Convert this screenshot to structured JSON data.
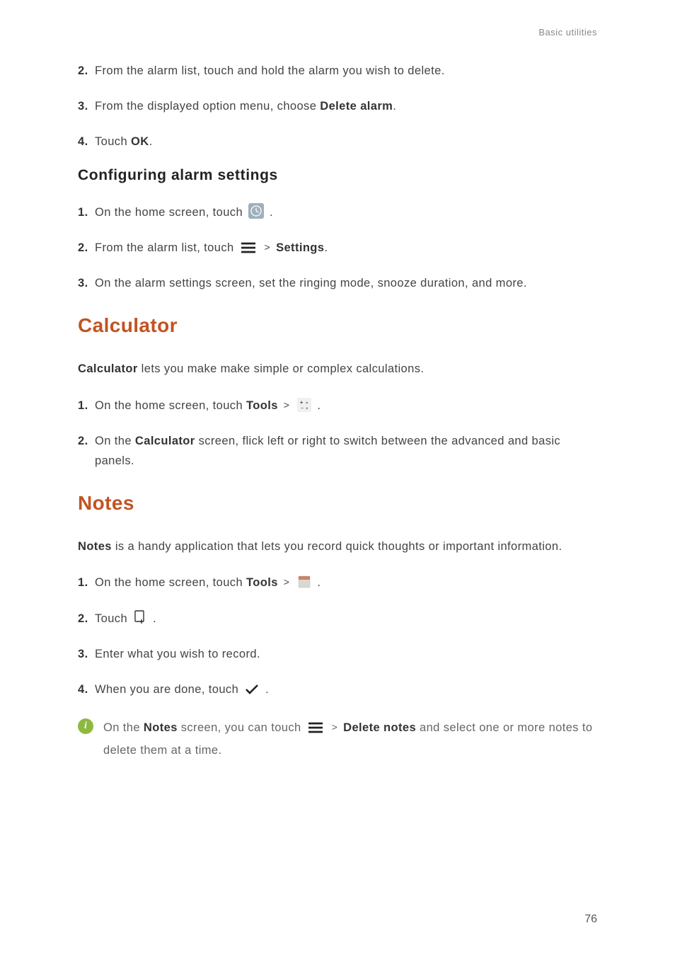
{
  "header": {
    "section": "Basic utilities"
  },
  "deleteAlarm": {
    "steps": [
      {
        "num": "2.",
        "text": "From the alarm list, touch and hold the alarm you wish to delete."
      },
      {
        "num": "3.",
        "pre": "From the displayed option menu, choose ",
        "bold": "Delete alarm",
        "post": "."
      },
      {
        "num": "4.",
        "pre": "Touch ",
        "bold": "OK",
        "post": "."
      }
    ]
  },
  "configHeading": "Configuring alarm settings",
  "config": {
    "step1": {
      "num": "1.",
      "pre": "On the home screen, touch ",
      "post": "."
    },
    "step2": {
      "num": "2.",
      "pre": "From the alarm list, touch ",
      "gt": ">",
      "bold": "Settings",
      "post": "."
    },
    "step3": {
      "num": "3.",
      "text": "On the alarm settings screen, set the ringing mode, snooze duration, and more."
    }
  },
  "calc": {
    "heading": "Calculator",
    "intro": {
      "bold": "Calculator",
      "post": " lets you make make simple or complex calculations."
    },
    "step1": {
      "num": "1.",
      "pre": "On the home screen, touch ",
      "bold": "Tools",
      "gt": ">",
      "post": "."
    },
    "step2": {
      "num": "2.",
      "pre": "On the ",
      "bold": "Calculator",
      "post": " screen, flick left or right to switch between the advanced and basic panels."
    }
  },
  "notes": {
    "heading": "Notes",
    "intro": {
      "bold": "Notes",
      "post": " is a handy application that lets you record quick thoughts or important information."
    },
    "step1": {
      "num": "1.",
      "pre": "On the home screen, touch ",
      "bold": "Tools",
      "gt": ">",
      "post": "."
    },
    "step2": {
      "num": "2.",
      "pre": "Touch ",
      "post": "."
    },
    "step3": {
      "num": "3.",
      "text": "Enter what you wish to record."
    },
    "step4": {
      "num": "4.",
      "pre": "When you are done, touch ",
      "post": "."
    },
    "tip": {
      "pre": "On the ",
      "bold1": "Notes",
      "mid": " screen, you can touch ",
      "gt": ">",
      "bold2": "Delete notes",
      "post": " and select one or more notes to delete them at a time."
    }
  },
  "pageNumber": "76"
}
